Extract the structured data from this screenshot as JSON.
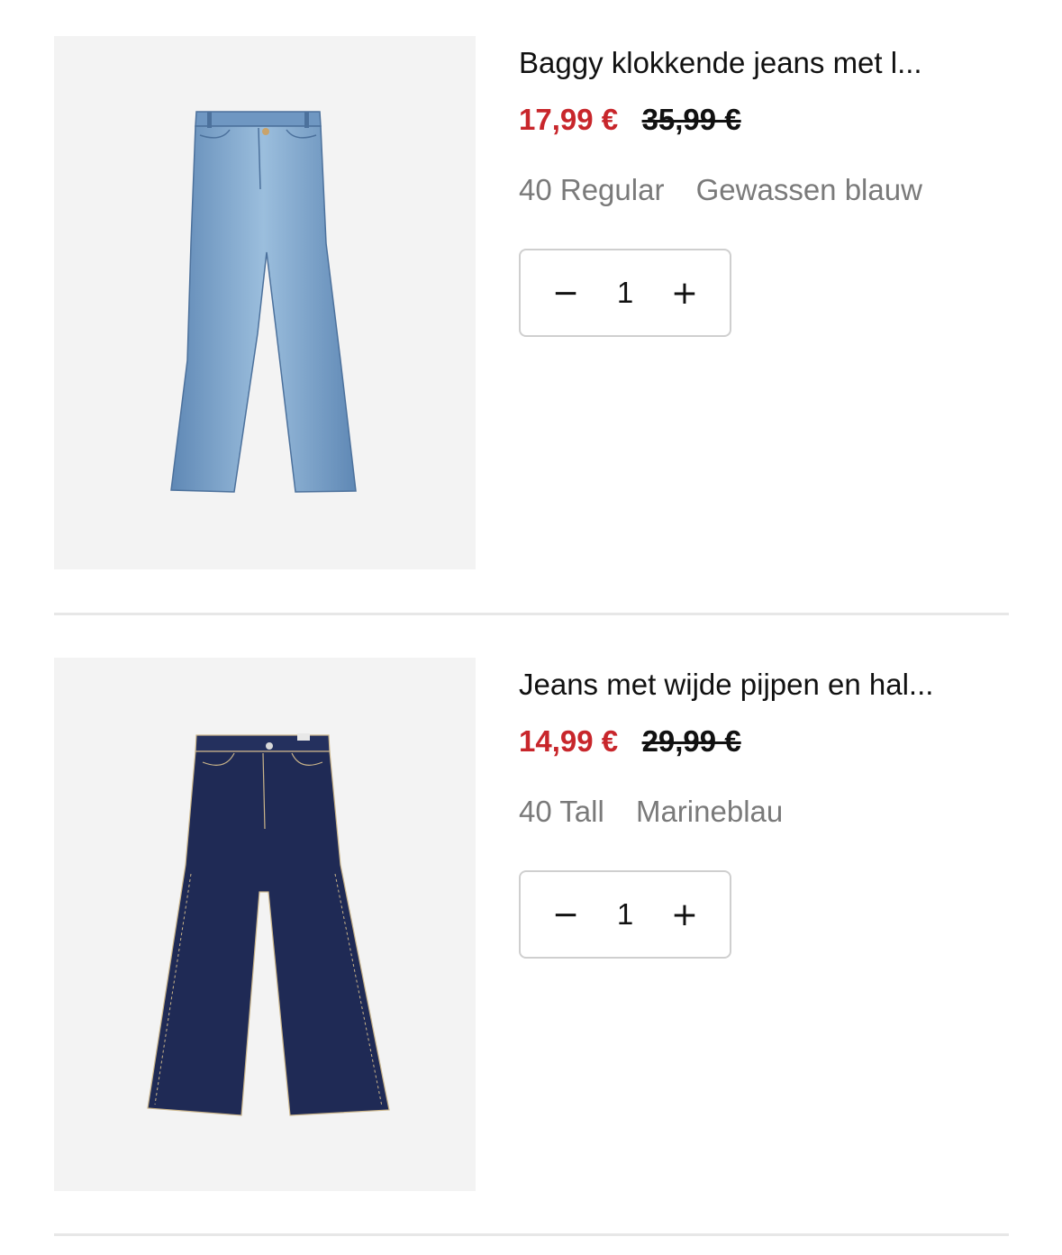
{
  "cart_items": [
    {
      "image_icon": "light-wash-flared-jeans",
      "title": "Baggy klokkende jeans met l...",
      "price_now": "17,99 €",
      "price_old": "35,99 €",
      "size": "40 Regular",
      "color": "Gewassen blauw",
      "quantity": "1",
      "decrement_label": "−",
      "increment_label": "+"
    },
    {
      "image_icon": "dark-wide-leg-jeans",
      "title": "Jeans met wijde pijpen en hal...",
      "price_now": "14,99 €",
      "price_old": "29,99 €",
      "size": "40 Tall",
      "color": "Marineblau",
      "quantity": "1",
      "decrement_label": "−",
      "increment_label": "+"
    }
  ],
  "colors": {
    "sale_price": "#c8262b",
    "secondary_text": "#7a7a7a",
    "thumb_background": "#f3f3f3",
    "light_denim": "#7fa6cc",
    "dark_denim": "#1f2a55"
  }
}
